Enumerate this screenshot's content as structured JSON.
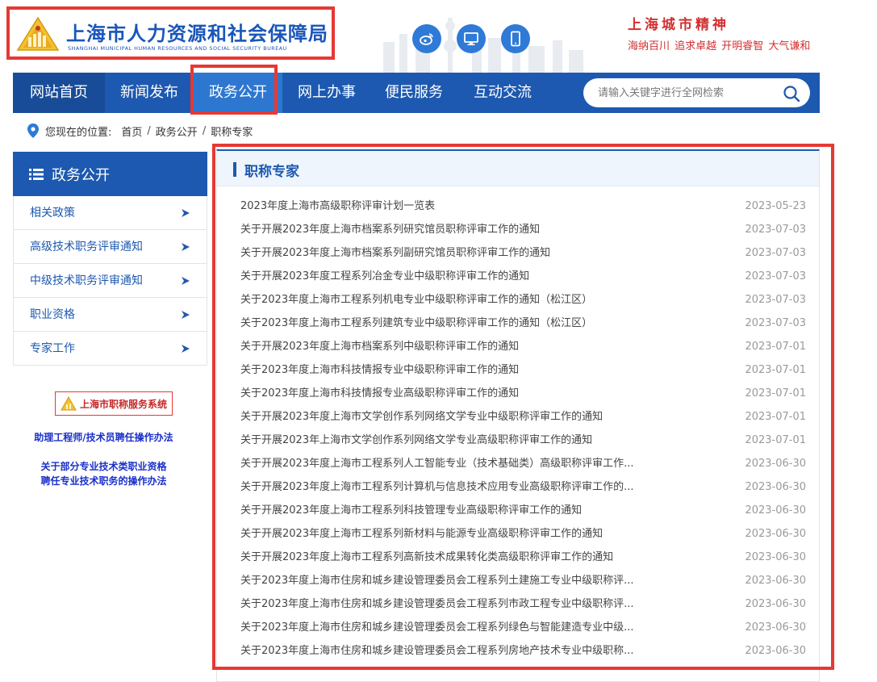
{
  "header": {
    "logo_cn": "上海市人力资源和社会保障局",
    "logo_en": "SHANGHAI MUNICIPAL HUMAN RESOURCES AND SOCIAL SECURITY BUREAU",
    "spirit_title": "上海城市精神",
    "spirit_subtitle": "海纳百川  追求卓越  开明睿智  大气谦和",
    "icons": [
      "weibo-icon",
      "desktop-icon",
      "mobile-icon"
    ]
  },
  "nav": {
    "items": [
      {
        "label": "网站首页"
      },
      {
        "label": "新闻发布"
      },
      {
        "label": "政务公开"
      },
      {
        "label": "网上办事"
      },
      {
        "label": "便民服务"
      },
      {
        "label": "互动交流"
      }
    ],
    "active_index": 2,
    "search_placeholder": "请输入关键字进行全网检索"
  },
  "breadcrumb": {
    "label": "您现在的位置:",
    "items": [
      "首页",
      "政务公开",
      "职称专家"
    ]
  },
  "sidebar": {
    "title": "政务公开",
    "items": [
      {
        "label": "相关政策"
      },
      {
        "label": "高级技术职务评审通知"
      },
      {
        "label": "中级技术职务评审通知"
      },
      {
        "label": "职业资格"
      },
      {
        "label": "专家工作"
      }
    ],
    "badge_text": "上海市职称服务系统",
    "link1": "助理工程师/技术员聘任操作办法",
    "link2_line1": "关于部分专业技术类职业资格",
    "link2_line2": "聘任专业技术职务的操作办法"
  },
  "main": {
    "title": "职称专家",
    "articles": [
      {
        "title": "2023年度上海市高级职称评审计划一览表",
        "date": "2023-05-23"
      },
      {
        "title": "关于开展2023年度上海市档案系列研究馆员职称评审工作的通知",
        "date": "2023-07-03"
      },
      {
        "title": "关于开展2023年度上海市档案系列副研究馆员职称评审工作的通知",
        "date": "2023-07-03"
      },
      {
        "title": "关于开展2023年度工程系列冶金专业中级职称评审工作的通知",
        "date": "2023-07-03"
      },
      {
        "title": "关于2023年度上海市工程系列机电专业中级职称评审工作的通知（松江区）",
        "date": "2023-07-03"
      },
      {
        "title": "关于2023年度上海市工程系列建筑专业中级职称评审工作的通知（松江区）",
        "date": "2023-07-03"
      },
      {
        "title": "关于开展2023年度上海市档案系列中级职称评审工作的通知",
        "date": "2023-07-01"
      },
      {
        "title": "关于2023年度上海市科技情报专业中级职称评审工作的通知",
        "date": "2023-07-01"
      },
      {
        "title": "关于2023年度上海市科技情报专业高级职称评审工作的通知",
        "date": "2023-07-01"
      },
      {
        "title": "关于开展2023年度上海市文学创作系列网络文学专业中级职称评审工作的通知",
        "date": "2023-07-01"
      },
      {
        "title": "关于开展2023年上海市文学创作系列网络文学专业高级职称评审工作的通知",
        "date": "2023-07-01"
      },
      {
        "title": "关于开展2023年度上海市工程系列人工智能专业（技术基础类）高级职称评审工作...",
        "date": "2023-06-30"
      },
      {
        "title": "关于开展2023年度上海市工程系列计算机与信息技术应用专业高级职称评审工作的...",
        "date": "2023-06-30"
      },
      {
        "title": "关于开展2023年度上海市工程系列科技管理专业高级职称评审工作的通知",
        "date": "2023-06-30"
      },
      {
        "title": "关于开展2023年度上海市工程系列新材料与能源专业高级职称评审工作的通知",
        "date": "2023-06-30"
      },
      {
        "title": "关于开展2023年度上海市工程系列高新技术成果转化类高级职称评审工作的通知",
        "date": "2023-06-30"
      },
      {
        "title": "关于2023年度上海市住房和城乡建设管理委员会工程系列土建施工专业中级职称评...",
        "date": "2023-06-30"
      },
      {
        "title": "关于2023年度上海市住房和城乡建设管理委员会工程系列市政工程专业中级职称评...",
        "date": "2023-06-30"
      },
      {
        "title": "关于2023年度上海市住房和城乡建设管理委员会工程系列绿色与智能建造专业中级...",
        "date": "2023-06-30"
      },
      {
        "title": "关于2023年度上海市住房和城乡建设管理委员会工程系列房地产技术专业中级职称...",
        "date": "2023-06-30"
      }
    ]
  },
  "colors": {
    "primary": "#1d59b0",
    "nav_active": "#2e77d0",
    "highlight": "#e53935",
    "spirit": "#d32f2f"
  }
}
